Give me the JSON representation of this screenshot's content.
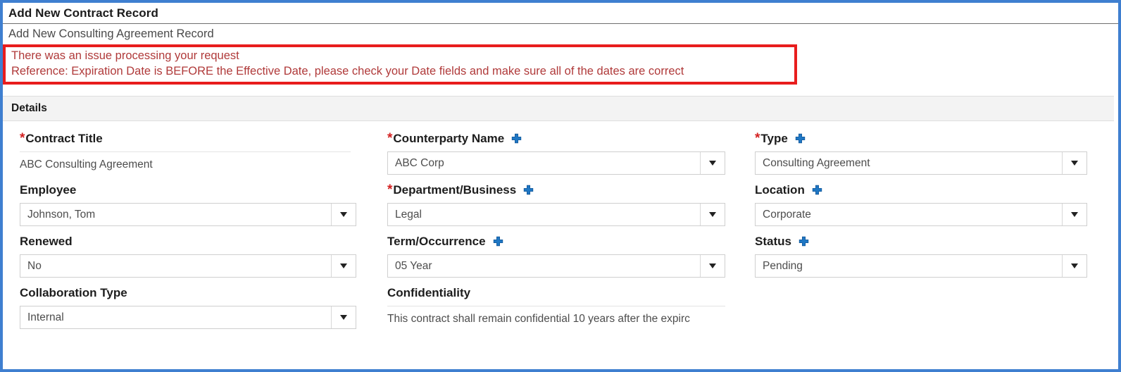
{
  "header": {
    "title": "Add New Contract Record",
    "subtitle": "Add New Consulting Agreement Record"
  },
  "error": {
    "line1": "There was an issue processing your request",
    "line2": "Reference: Expiration Date is BEFORE the Effective Date, please check your Date fields and make sure all of the dates are correct",
    "border_color": "#e81d1d",
    "text_color": "#b03a3a"
  },
  "section": {
    "details_label": "Details"
  },
  "icons": {
    "plus": "plus-icon",
    "caret": "chevron-down-icon"
  },
  "colors": {
    "frame": "#3f7fd0",
    "required_star": "#d32121",
    "plus_blue": "#1f77c4"
  },
  "required_marker": "*",
  "fields": {
    "contract_title": {
      "label": "Contract Title",
      "value": "ABC Consulting Agreement",
      "required": true,
      "type": "text"
    },
    "counterparty_name": {
      "label": "Counterparty Name",
      "value": "ABC Corp",
      "required": true,
      "type": "select",
      "has_add": true
    },
    "type": {
      "label": "Type",
      "value": "Consulting Agreement",
      "required": true,
      "type": "select",
      "has_add": true
    },
    "employee": {
      "label": "Employee",
      "value": "Johnson, Tom",
      "required": false,
      "type": "select",
      "has_add": false
    },
    "department_business": {
      "label": "Department/Business",
      "value": "Legal",
      "required": true,
      "type": "select",
      "has_add": true
    },
    "location": {
      "label": "Location",
      "value": "Corporate",
      "required": false,
      "type": "select",
      "has_add": true
    },
    "renewed": {
      "label": "Renewed",
      "value": "No",
      "required": false,
      "type": "select",
      "has_add": false
    },
    "term_occurrence": {
      "label": "Term/Occurrence",
      "value": "05 Year",
      "required": false,
      "type": "select",
      "has_add": true
    },
    "status": {
      "label": "Status",
      "value": "Pending",
      "required": false,
      "type": "select",
      "has_add": true
    },
    "collaboration_type": {
      "label": "Collaboration Type",
      "value": "Internal",
      "required": false,
      "type": "select",
      "has_add": false
    },
    "confidentiality": {
      "label": "Confidentiality",
      "value": "This contract shall remain confidential 10 years after the expirc",
      "required": false,
      "type": "text"
    }
  }
}
